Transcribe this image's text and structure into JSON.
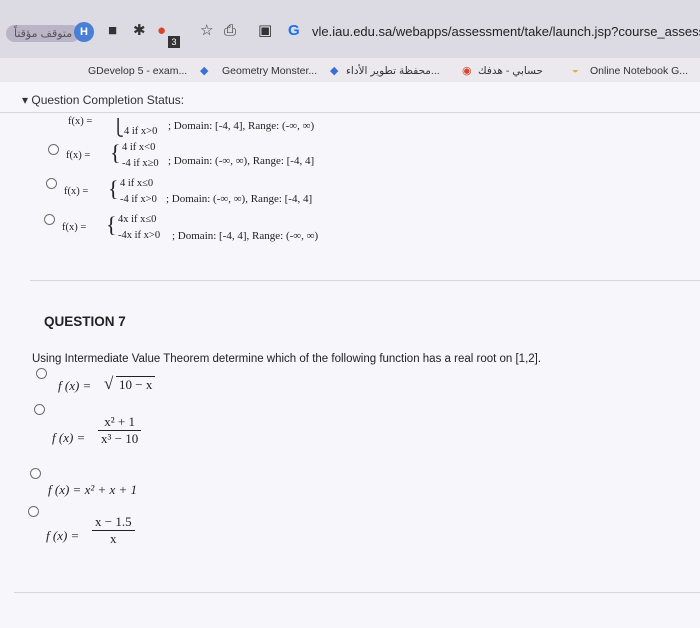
{
  "browser": {
    "left_pill": "متوقف مؤقتاً",
    "profile_initial": "H",
    "tab_count_badge": "3",
    "url": "vle.iau.edu.sa/webapps/assessment/take/launch.jsp?course_assessment",
    "bookmarks": [
      {
        "label": "GDevelop 5 - exam..."
      },
      {
        "label": "Geometry Monster..."
      },
      {
        "label": "محفظة تطوير الأداء..."
      },
      {
        "label": "حسابي - هدفك"
      },
      {
        "label": "Online Notebook G..."
      }
    ]
  },
  "status_toggle": "Question Completion Status:",
  "q6": {
    "options": [
      {
        "top_case": "",
        "bottom_case": "4   if x>0",
        "domain": "; Domain: [-4, 4], Range: (-∞, ∞)"
      },
      {
        "top_case": "4   if x<0",
        "bottom_case": "-4  if x≥0",
        "domain": "; Domain: (-∞, ∞), Range: [-4, 4]"
      },
      {
        "top_case": "4   if x≤0",
        "bottom_case": "-4  if x>0",
        "domain": "; Domain: (-∞, ∞), Range: [-4, 4]"
      },
      {
        "top_case": "4x   if x≤0",
        "bottom_case": "-4x  if x>0",
        "domain": "; Domain: [-4, 4], Range: (-∞, ∞)"
      }
    ],
    "f_label": "f(x) ="
  },
  "q7": {
    "title": "QUESTION 7",
    "prompt": "Using Intermediate Value Theorem determine which of the following function has a real root on [1,2].",
    "options": {
      "a": {
        "lhs": "f (x) =",
        "radicand": "10 − x"
      },
      "b": {
        "lhs": "f (x) =",
        "numerator": "x² + 1",
        "denominator": "x³ − 10"
      },
      "c": {
        "expr": "f (x) = x² + x + 1"
      },
      "d": {
        "lhs": "f (x) =",
        "numerator": "x − 1.5",
        "denominator": "x"
      }
    }
  }
}
